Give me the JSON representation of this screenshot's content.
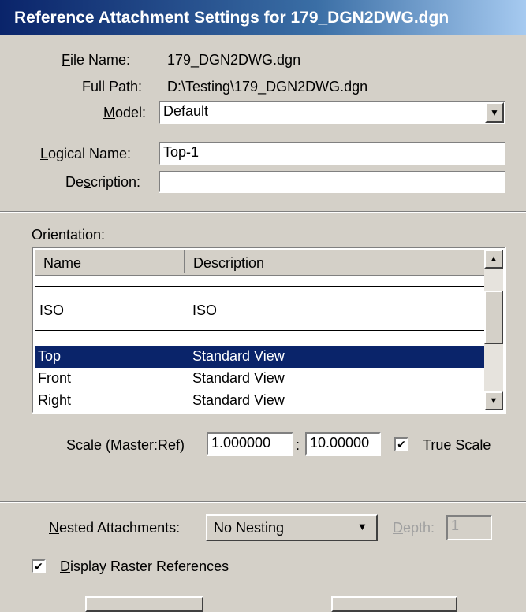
{
  "window": {
    "title": "Reference Attachment Settings for 179_DGN2DWG.dgn"
  },
  "file": {
    "file_name_label": "File Name:",
    "file_name_value": "179_DGN2DWG.dgn",
    "full_path_label": "Full Path:",
    "full_path_value": "D:\\Testing\\179_DGN2DWG.dgn",
    "model_label": "Model:",
    "model_value": "Default"
  },
  "naming": {
    "logical_name_label": "Logical Name:",
    "logical_name_value": "Top-1",
    "description_label": "Description:",
    "description_value": ""
  },
  "orientation": {
    "label": "Orientation:",
    "columns": [
      "Name",
      "Description"
    ],
    "rows": [
      {
        "name": "",
        "description": ""
      },
      {
        "name": "ISO",
        "description": "ISO"
      },
      {
        "name": "",
        "description": ""
      },
      {
        "name": "Top",
        "description": "Standard View",
        "selected": true
      },
      {
        "name": "Front",
        "description": "Standard View"
      },
      {
        "name": "Right",
        "description": "Standard View"
      }
    ]
  },
  "scale": {
    "label": "Scale (Master:Ref)",
    "master_value": "1.000000",
    "separator": ":",
    "ref_value": "10.00000",
    "true_scale_label": "True Scale",
    "true_scale_checked": true
  },
  "nesting": {
    "label": "Nested Attachments:",
    "value": "No Nesting",
    "depth_label": "Depth:",
    "depth_value": "1"
  },
  "raster": {
    "label": "Display Raster References",
    "checked": true
  },
  "icons": {
    "dropdown": "chevron-down-icon",
    "scroll_up": "arrow-up-icon",
    "scroll_down": "arrow-down-icon",
    "checkmark": "checkmark-icon"
  },
  "colors": {
    "titlebar_start": "#0a246a",
    "titlebar_end": "#a6caf0",
    "selection": "#0a246a",
    "face": "#d4d0c8"
  }
}
